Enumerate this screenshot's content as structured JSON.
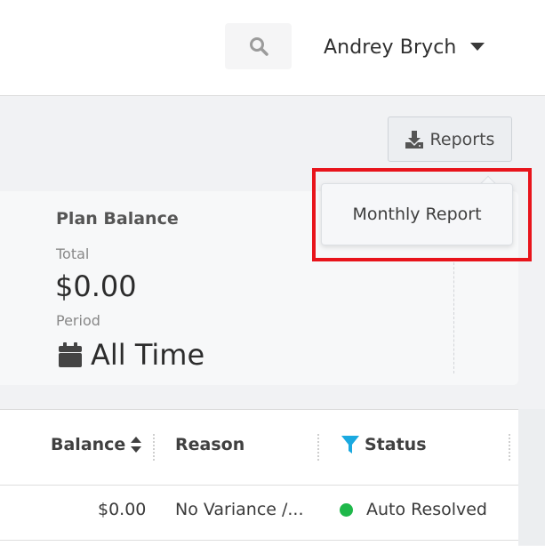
{
  "header": {
    "user_name": "Andrey Brych",
    "search_icon": "search-icon",
    "user_menu_icon": "caret-down-icon"
  },
  "toolbar": {
    "reports_label": "Reports",
    "reports_icon": "download-icon"
  },
  "reports_menu": {
    "items": [
      {
        "label": "Monthly Report"
      }
    ]
  },
  "plan_card": {
    "title": "Plan Balance",
    "total_label": "Total",
    "total_value": "$0.00",
    "period_label": "Period",
    "period_value": "All Time",
    "period_icon": "calendar-icon"
  },
  "table": {
    "columns": [
      {
        "label": "Balance",
        "icon": "sort-icon"
      },
      {
        "label": "Reason"
      },
      {
        "label": "Status",
        "icon": "filter-icon"
      }
    ],
    "rows": [
      {
        "balance": "$0.00",
        "reason": "No Variance /...",
        "status": "Auto Resolved",
        "status_color": "#1fb84a"
      }
    ]
  },
  "colors": {
    "highlight": "#e8141b",
    "filter_icon": "#1aa9e0",
    "status_ok": "#1fb84a"
  }
}
